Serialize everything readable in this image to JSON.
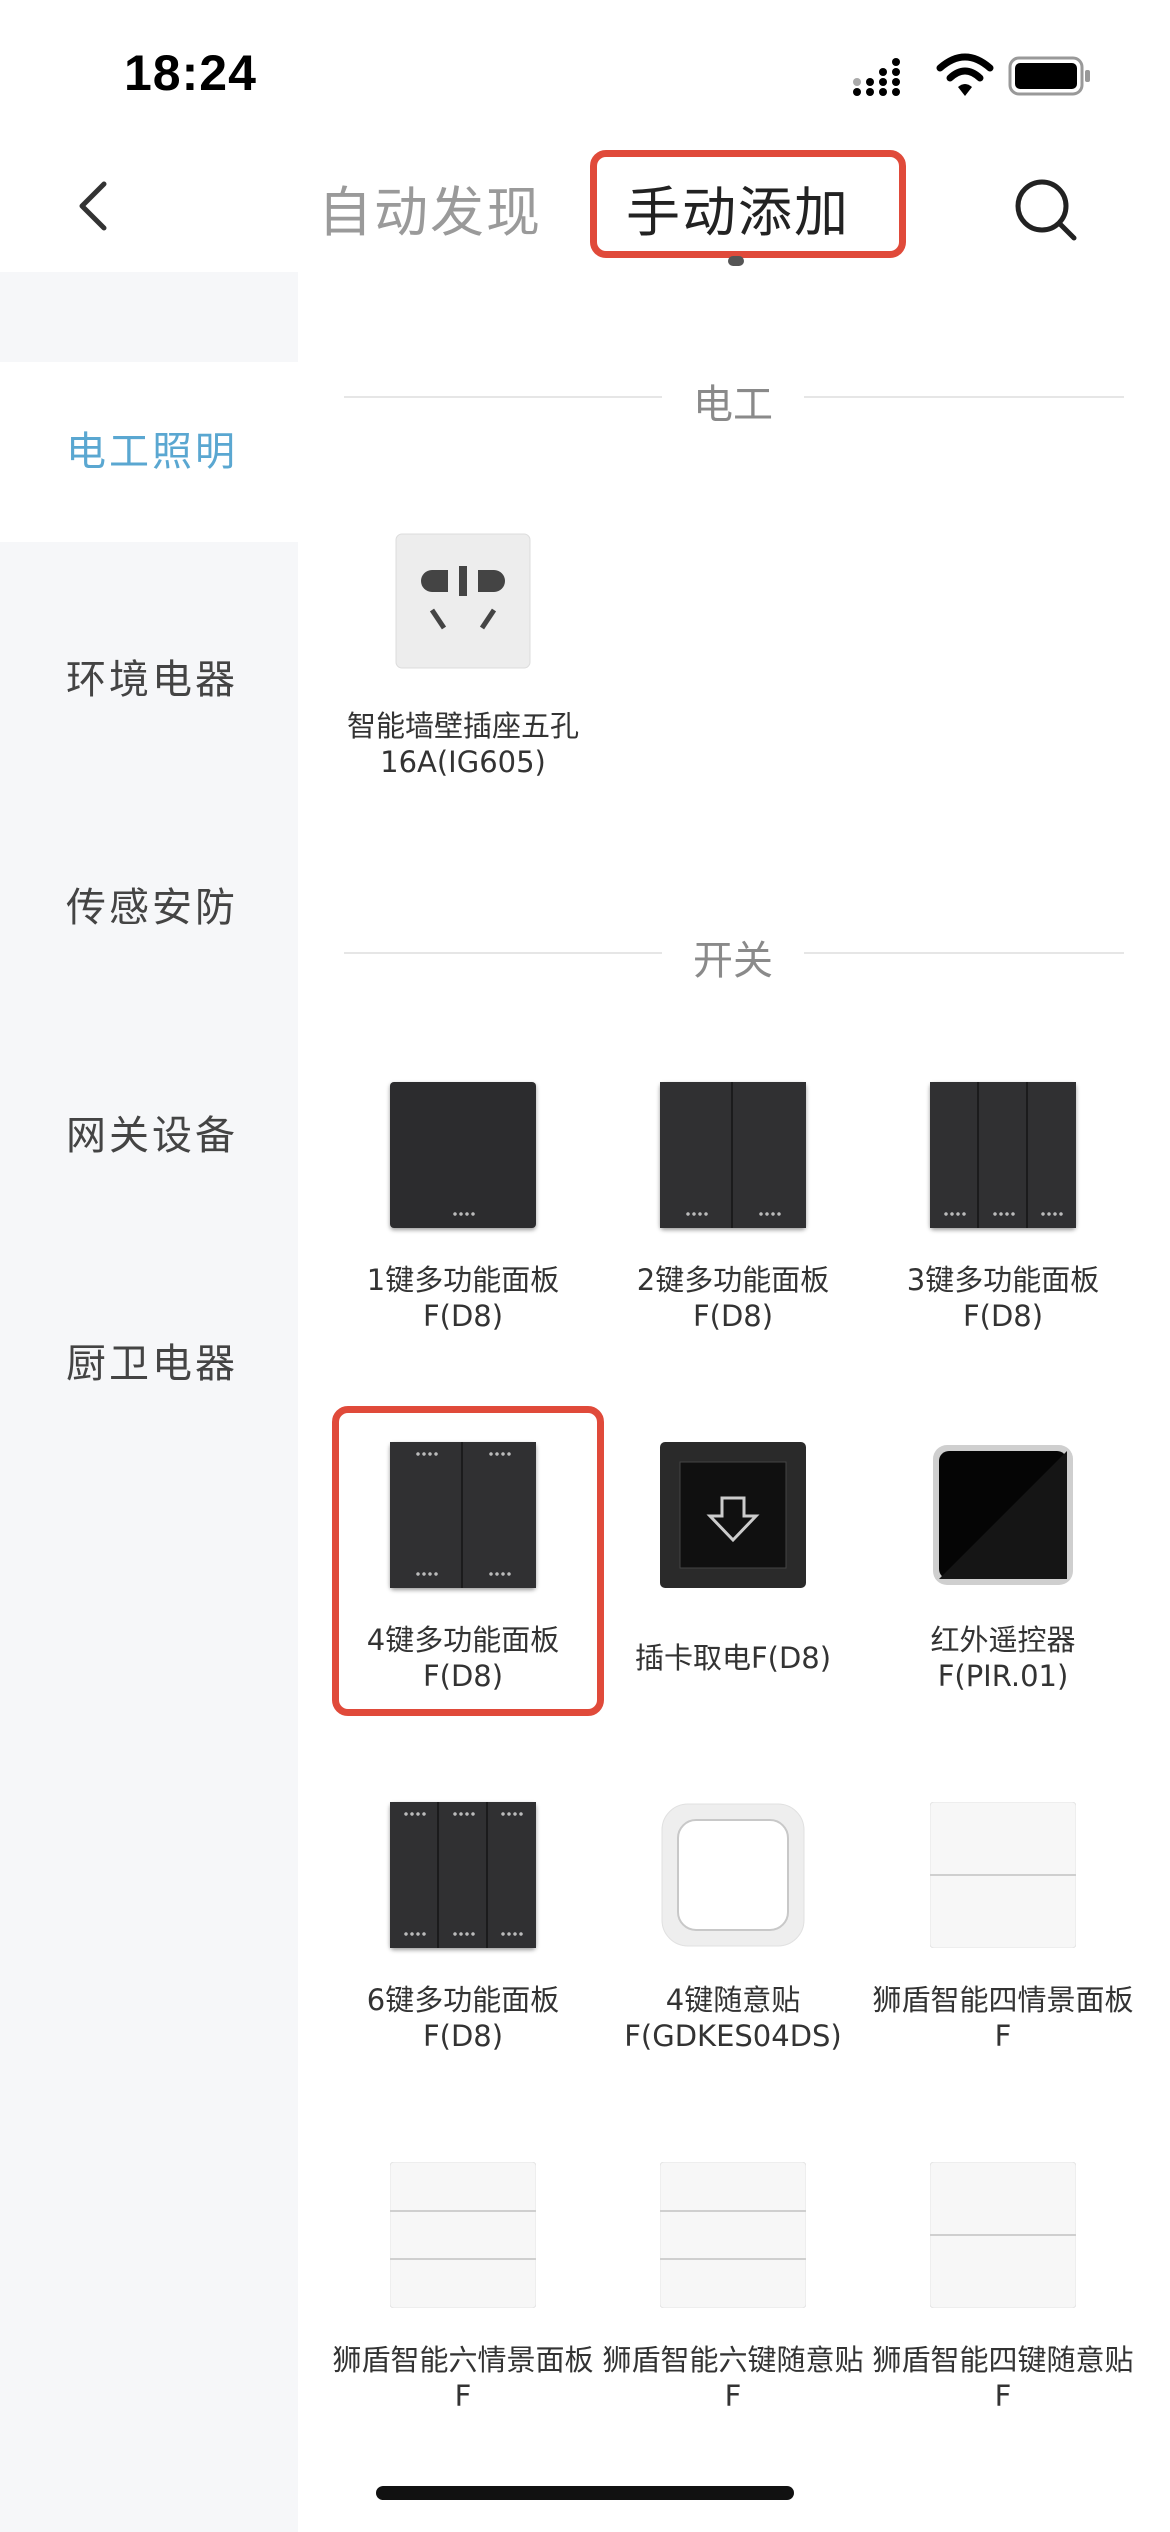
{
  "status_bar": {
    "time": "18:24"
  },
  "header": {
    "tabs": [
      {
        "label": "自动发现",
        "active": false
      },
      {
        "label": "手动添加",
        "active": true
      }
    ]
  },
  "sidebar": {
    "items": [
      {
        "label": "电工照明",
        "active": true
      },
      {
        "label": "环境电器",
        "active": false
      },
      {
        "label": "传感安防",
        "active": false
      },
      {
        "label": "网关设备",
        "active": false
      },
      {
        "label": "厨卫电器",
        "active": false
      }
    ]
  },
  "sections": [
    {
      "title": "电工",
      "items": [
        {
          "label": "智能墙壁插座五孔16A(IG605)",
          "icon": "wall-socket-icon"
        }
      ]
    },
    {
      "title": "开关",
      "items": [
        {
          "label": "1键多功能面板F(D8)",
          "icon": "switch-1-gang-icon"
        },
        {
          "label": "2键多功能面板F(D8)",
          "icon": "switch-2-gang-icon"
        },
        {
          "label": "3键多功能面板F(D8)",
          "icon": "switch-3-gang-icon"
        },
        {
          "label": "4键多功能面板F(D8)",
          "icon": "switch-4-gang-icon",
          "highlighted": true
        },
        {
          "label": "插卡取电F(D8)",
          "icon": "card-power-icon"
        },
        {
          "label": "红外遥控器F(PIR.01)",
          "icon": "ir-remote-icon"
        },
        {
          "label": "6键多功能面板F(D8)",
          "icon": "switch-6-gang-icon"
        },
        {
          "label": "4键随意贴F(GDKES04DS)",
          "icon": "sticker-switch-icon"
        },
        {
          "label": "狮盾智能四情景面板F",
          "icon": "scene-panel-4-icon"
        },
        {
          "label": "狮盾智能六情景面板F",
          "icon": "scene-panel-6-icon"
        },
        {
          "label": "狮盾智能六键随意贴F",
          "icon": "sticker-6-key-icon"
        },
        {
          "label": "狮盾智能四键随意贴F",
          "icon": "sticker-4-key-icon"
        }
      ]
    }
  ],
  "colors": {
    "active_sidebar": "#5aa7d1",
    "highlight": "#e04a3a",
    "sidebar_bg": "#f6f7f9"
  }
}
